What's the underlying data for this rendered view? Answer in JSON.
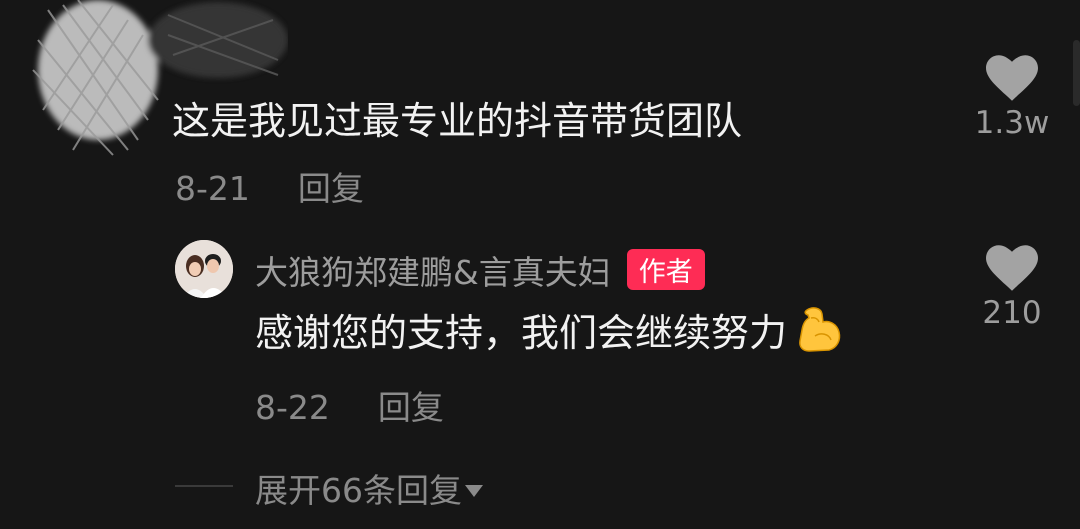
{
  "comment": {
    "text": "这是我见过最专业的抖音带货团队",
    "date": "8-21",
    "reply_label": "回复",
    "like_count": "1.3w",
    "like_icon": "heart-icon"
  },
  "reply": {
    "username": "大狼狗郑建鹏&言真夫妇",
    "badge": "作者",
    "text": "感谢您的支持，我们会继续努力",
    "emoji_icon": "flexed-biceps-icon",
    "date": "8-22",
    "reply_label": "回复",
    "like_count": "210",
    "like_icon": "heart-icon"
  },
  "expand": {
    "label": "展开66条回复",
    "icon": "caret-down-icon"
  },
  "colors": {
    "background": "#161616",
    "badge": "#fe2c55",
    "text": "#f2f2f2",
    "meta": "#8a8a8a"
  }
}
